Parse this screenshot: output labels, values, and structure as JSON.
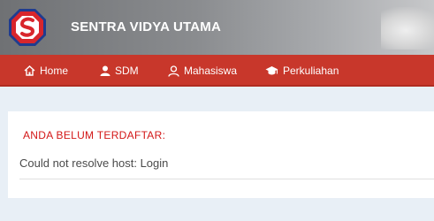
{
  "header": {
    "brand": "SENTRA VIDYA UTAMA",
    "logo_icon": "sevima-logo-icon"
  },
  "nav": {
    "items": [
      {
        "label": "Home",
        "icon": "home-icon"
      },
      {
        "label": "SDM",
        "icon": "user-icon"
      },
      {
        "label": "Mahasiswa",
        "icon": "student-icon"
      },
      {
        "label": "Perkuliahan",
        "icon": "graduation-cap-icon"
      }
    ]
  },
  "main": {
    "alert_title": "ANDA BELUM TERDAFTAR:",
    "message": "Could not resolve host: Login"
  },
  "colors": {
    "nav_bg": "#c8372b",
    "alert": "#d31717",
    "page_bg": "#e8eff6"
  }
}
